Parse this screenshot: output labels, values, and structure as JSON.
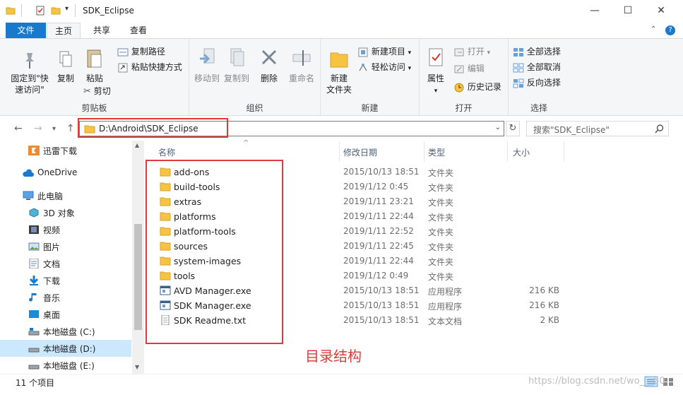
{
  "window": {
    "title": "SDK_Eclipse",
    "minimize": "—",
    "maximize": "☐",
    "close": "✕"
  },
  "tabs": [
    {
      "label": "文件"
    },
    {
      "label": "主页"
    },
    {
      "label": "共享"
    },
    {
      "label": "查看"
    }
  ],
  "ribbon": {
    "clipboard": {
      "label": "剪贴板",
      "pin": "固定到\"快速访问\"",
      "copy": "复制",
      "paste": "粘贴",
      "copy_path": "复制路径",
      "paste_shortcut": "粘贴快捷方式",
      "cut": "剪切"
    },
    "organize": {
      "label": "组织",
      "move_to": "移动到",
      "copy_to": "复制到",
      "delete": "删除",
      "rename": "重命名"
    },
    "new": {
      "label": "新建",
      "new_folder": "新建\n文件夹",
      "new_item": "新建项目",
      "easy_access": "轻松访问"
    },
    "open": {
      "label": "打开",
      "properties": "属性",
      "open": "打开",
      "edit": "编辑",
      "history": "历史记录"
    },
    "select": {
      "label": "选择",
      "select_all": "全部选择",
      "select_none": "全部取消",
      "invert": "反向选择"
    }
  },
  "address": {
    "path": "D:\\Android\\SDK_Eclipse",
    "search_placeholder": "搜索\"SDK_Eclipse\""
  },
  "sidebar": {
    "items": [
      {
        "label": "迅雷下载"
      },
      {
        "label": "OneDrive"
      },
      {
        "label": "此电脑"
      },
      {
        "label": "3D 对象"
      },
      {
        "label": "视频"
      },
      {
        "label": "图片"
      },
      {
        "label": "文档"
      },
      {
        "label": "下载"
      },
      {
        "label": "音乐"
      },
      {
        "label": "桌面"
      },
      {
        "label": "本地磁盘 (C:)"
      },
      {
        "label": "本地磁盘 (D:)"
      },
      {
        "label": "本地磁盘 (E:)"
      }
    ]
  },
  "columns": {
    "name": "名称",
    "date": "修改日期",
    "type": "类型",
    "size": "大小"
  },
  "files": [
    {
      "name": "add-ons",
      "date": "2015/10/13 18:51",
      "type": "文件夹",
      "size": "",
      "kind": "folder"
    },
    {
      "name": "build-tools",
      "date": "2019/1/12 0:45",
      "type": "文件夹",
      "size": "",
      "kind": "folder"
    },
    {
      "name": "extras",
      "date": "2019/1/11 23:21",
      "type": "文件夹",
      "size": "",
      "kind": "folder"
    },
    {
      "name": "platforms",
      "date": "2019/1/11 22:44",
      "type": "文件夹",
      "size": "",
      "kind": "folder"
    },
    {
      "name": "platform-tools",
      "date": "2019/1/11 22:52",
      "type": "文件夹",
      "size": "",
      "kind": "folder"
    },
    {
      "name": "sources",
      "date": "2019/1/11 22:45",
      "type": "文件夹",
      "size": "",
      "kind": "folder"
    },
    {
      "name": "system-images",
      "date": "2019/1/11 22:44",
      "type": "文件夹",
      "size": "",
      "kind": "folder"
    },
    {
      "name": "tools",
      "date": "2019/1/12 0:49",
      "type": "文件夹",
      "size": "",
      "kind": "folder"
    },
    {
      "name": "AVD Manager.exe",
      "date": "2015/10/13 18:51",
      "type": "应用程序",
      "size": "216 KB",
      "kind": "exe"
    },
    {
      "name": "SDK Manager.exe",
      "date": "2015/10/13 18:51",
      "type": "应用程序",
      "size": "216 KB",
      "kind": "exe"
    },
    {
      "name": "SDK Readme.txt",
      "date": "2015/10/13 18:51",
      "type": "文本文档",
      "size": "2 KB",
      "kind": "txt"
    }
  ],
  "status": {
    "item_count": "11 个项目"
  },
  "annotation": "目录结构",
  "watermark": "https://blog.csdn.net/wo___50",
  "colors": {
    "accent": "#1979ca",
    "folder": "#f6c342",
    "selected": "#cce8ff",
    "annotation_red": "#e03a3a"
  }
}
